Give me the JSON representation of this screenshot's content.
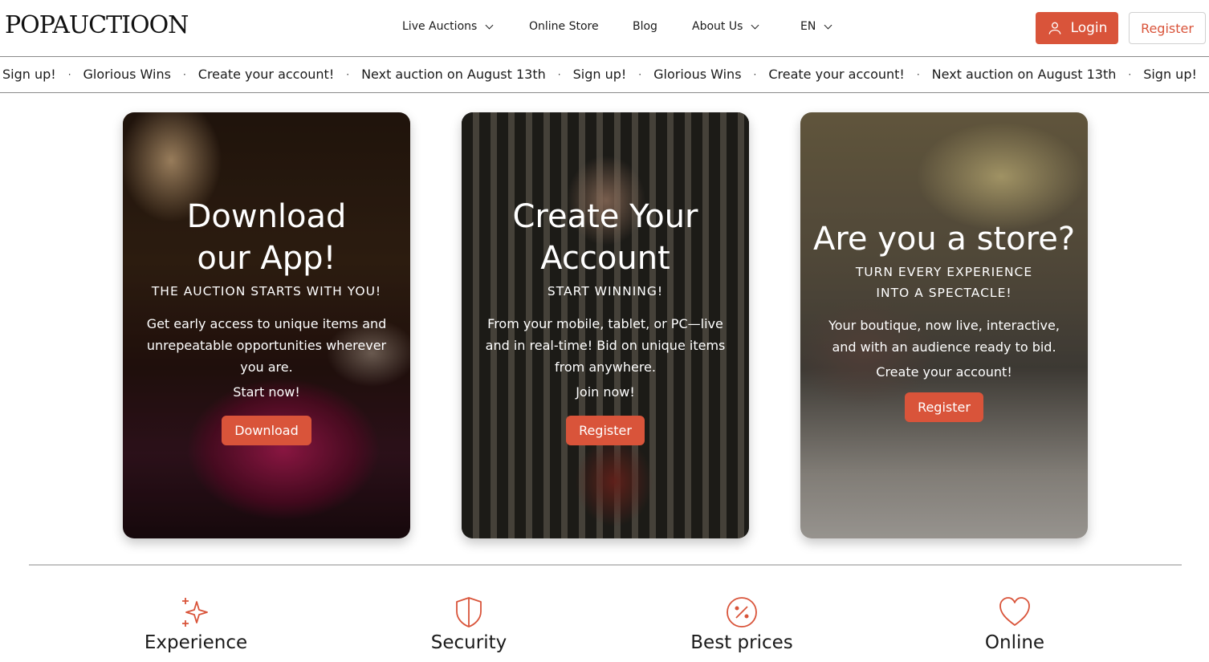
{
  "header": {
    "logo": "POPAUCTIOON",
    "nav": {
      "live_auctions": "Live Auctions",
      "online_store": "Online Store",
      "blog": "Blog",
      "about_us": "About Us",
      "language": "EN"
    },
    "login_label": "Login",
    "register_label": "Register"
  },
  "ticker": {
    "items": [
      "Sign up!",
      "Glorious Wins",
      "Create your account!",
      "Next auction on August 13th",
      "Sign up!",
      "Glorious Wins",
      "Create your account!",
      "Next auction on August 13th",
      "Sign up!"
    ],
    "separator": "·"
  },
  "cards": [
    {
      "title_line1": "Download",
      "title_line2": "our App!",
      "subtitle": "THE AUCTION STARTS WITH YOU!",
      "body": "Get early access to unique items and unrepeatable opportunities wherever you are.",
      "cta_text": "Start now!",
      "button": "Download"
    },
    {
      "title_line1": "Create Your",
      "title_line2": "Account",
      "subtitle": "START WINNING!",
      "body": "From your mobile, tablet, or PC—live and in real-time! Bid on unique items from anywhere.",
      "cta_text": "Join now!",
      "button": "Register"
    },
    {
      "title_line1": "Are you a store?",
      "subtitle_line1": "TURN EVERY EXPERIENCE",
      "subtitle_line2": "INTO A SPECTACLE!",
      "body": "Your boutique, now live, interactive, and with an audience ready to bid.",
      "cta_text": "Create your account!",
      "button": "Register"
    }
  ],
  "features": [
    {
      "label": "Experience",
      "icon": "sparkles-icon"
    },
    {
      "label": "Security",
      "icon": "shield-icon"
    },
    {
      "label": "Best prices",
      "icon": "percent-badge-icon"
    },
    {
      "label": "Online",
      "icon": "heart-icon"
    }
  ],
  "colors": {
    "accent": "#d9543a"
  }
}
